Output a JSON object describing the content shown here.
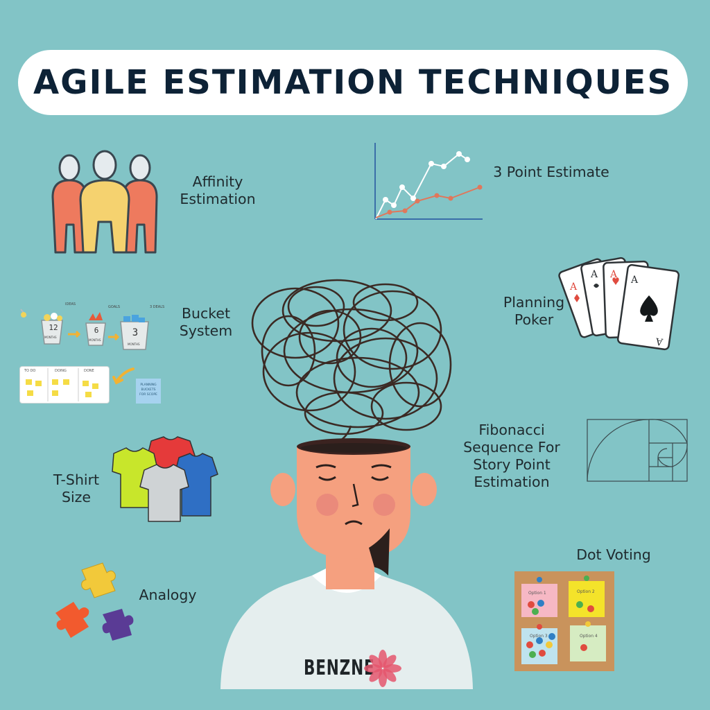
{
  "title": "AGILE ESTIMATION TECHNIQUES",
  "techniques": {
    "affinity": {
      "line1": "Affinity",
      "line2": "Estimation"
    },
    "three_point": {
      "label": "3 Point Estimate"
    },
    "bucket": {
      "line1": "Bucket",
      "line2": "System",
      "bucket_values": [
        "12",
        "6",
        "3"
      ],
      "bucket_unit": "MONTHS",
      "bucket_tags": [
        "IDEAS",
        "GOALS",
        "3 DEALS"
      ],
      "board_cols": [
        "TO DO",
        "DOING",
        "DONE"
      ],
      "note": [
        "PLANNING",
        "BUCKETS",
        "FOR SCOPE"
      ]
    },
    "poker": {
      "line1": "Planning",
      "line2": "Poker",
      "card_rank": "A"
    },
    "tshirt": {
      "line1": "T-Shirt",
      "line2": "Size"
    },
    "fibonacci": {
      "line1": "Fibonacci",
      "line2": "Sequence For",
      "line3": "Story Point",
      "line4": "Estimation"
    },
    "analogy": {
      "label": "Analogy"
    },
    "dot_voting": {
      "label": "Dot Voting",
      "options": [
        "Option 1",
        "Option 2",
        "Option 3",
        "Option 4"
      ]
    }
  },
  "brand": {
    "name": "BENZNE"
  },
  "colors": {
    "background": "#82c4c6",
    "title_text": "#0d2236",
    "accent_orange": "#ee7a5e",
    "accent_yellow": "#f5d26f"
  }
}
